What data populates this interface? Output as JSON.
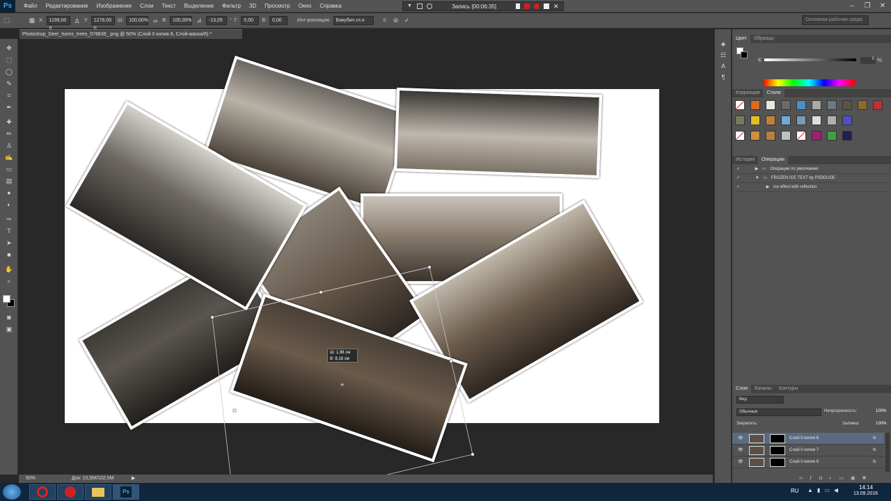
{
  "menubar": {
    "logo": "Ps",
    "items": [
      "Файл",
      "Редактирование",
      "Изображение",
      "Слои",
      "Текст",
      "Выделение",
      "Фильтр",
      "3D",
      "Просмотр",
      "Окно",
      "Справка"
    ],
    "recording": "Запись [00:06:35]"
  },
  "options": {
    "x_label": "X:",
    "x_value": "1199,00 п",
    "y_label": "Y:",
    "y_value": "1278,00 п",
    "w_label": "Ш:",
    "w_value": "100,00%",
    "h_label": "В:",
    "h_value": "100,00%",
    "angle_value": "-13,05",
    "angle_unit": "°",
    "hskew_label": "Г:",
    "hskew_value": "0,00",
    "vskew_label": "В:",
    "vskew_value": "0,00",
    "interp_label": "Инт-ропляция:",
    "interp_value": "Бикубич.гл.н",
    "workspace": "Основная рабочая среда"
  },
  "document": {
    "tab_title": "Photoshop_Deer_horns_trees_078639_.png @ 50% (Слой 0 копия 8, Слой-маска/8) *",
    "tooltip_w": "Ш: 1,98 см",
    "tooltip_h": "В: 8,18 см"
  },
  "status": {
    "zoom": "50%",
    "doc": "Док: 10,5M/102,5M"
  },
  "color_panel": {
    "tabs": [
      "Цвет",
      "Образцы"
    ],
    "k_label": "K",
    "k_value": "0",
    "k_unit": "%"
  },
  "styles_panel": {
    "tabs": [
      "Коррекция",
      "Стили"
    ]
  },
  "actions_panel": {
    "tabs": [
      "История",
      "Операции"
    ],
    "rows": [
      "Операции по умолчанию",
      "FROZEN ICE TEXT by PSDDUDE",
      "Ice effect with reflection"
    ]
  },
  "layers_panel": {
    "tabs": [
      "Слои",
      "Каналы",
      "Контуры"
    ],
    "filter": "Вид",
    "blend_mode": "Обычные",
    "opacity_label": "Непрозрачность:",
    "opacity_value": "100%",
    "lock_label": "Закрепить:",
    "fill_label": "Заливка:",
    "fill_value": "100%",
    "layers": [
      "Слой 0 копия 8",
      "Слой 0 копия 7",
      "Слой 0 копия 6"
    ],
    "fx": "fx"
  },
  "taskbar": {
    "lang": "RU",
    "time": "14:14",
    "date": "13.09.2016"
  },
  "colors": {
    "panel": "#535353",
    "dark": "#282828",
    "accent": "#31a8ff"
  }
}
